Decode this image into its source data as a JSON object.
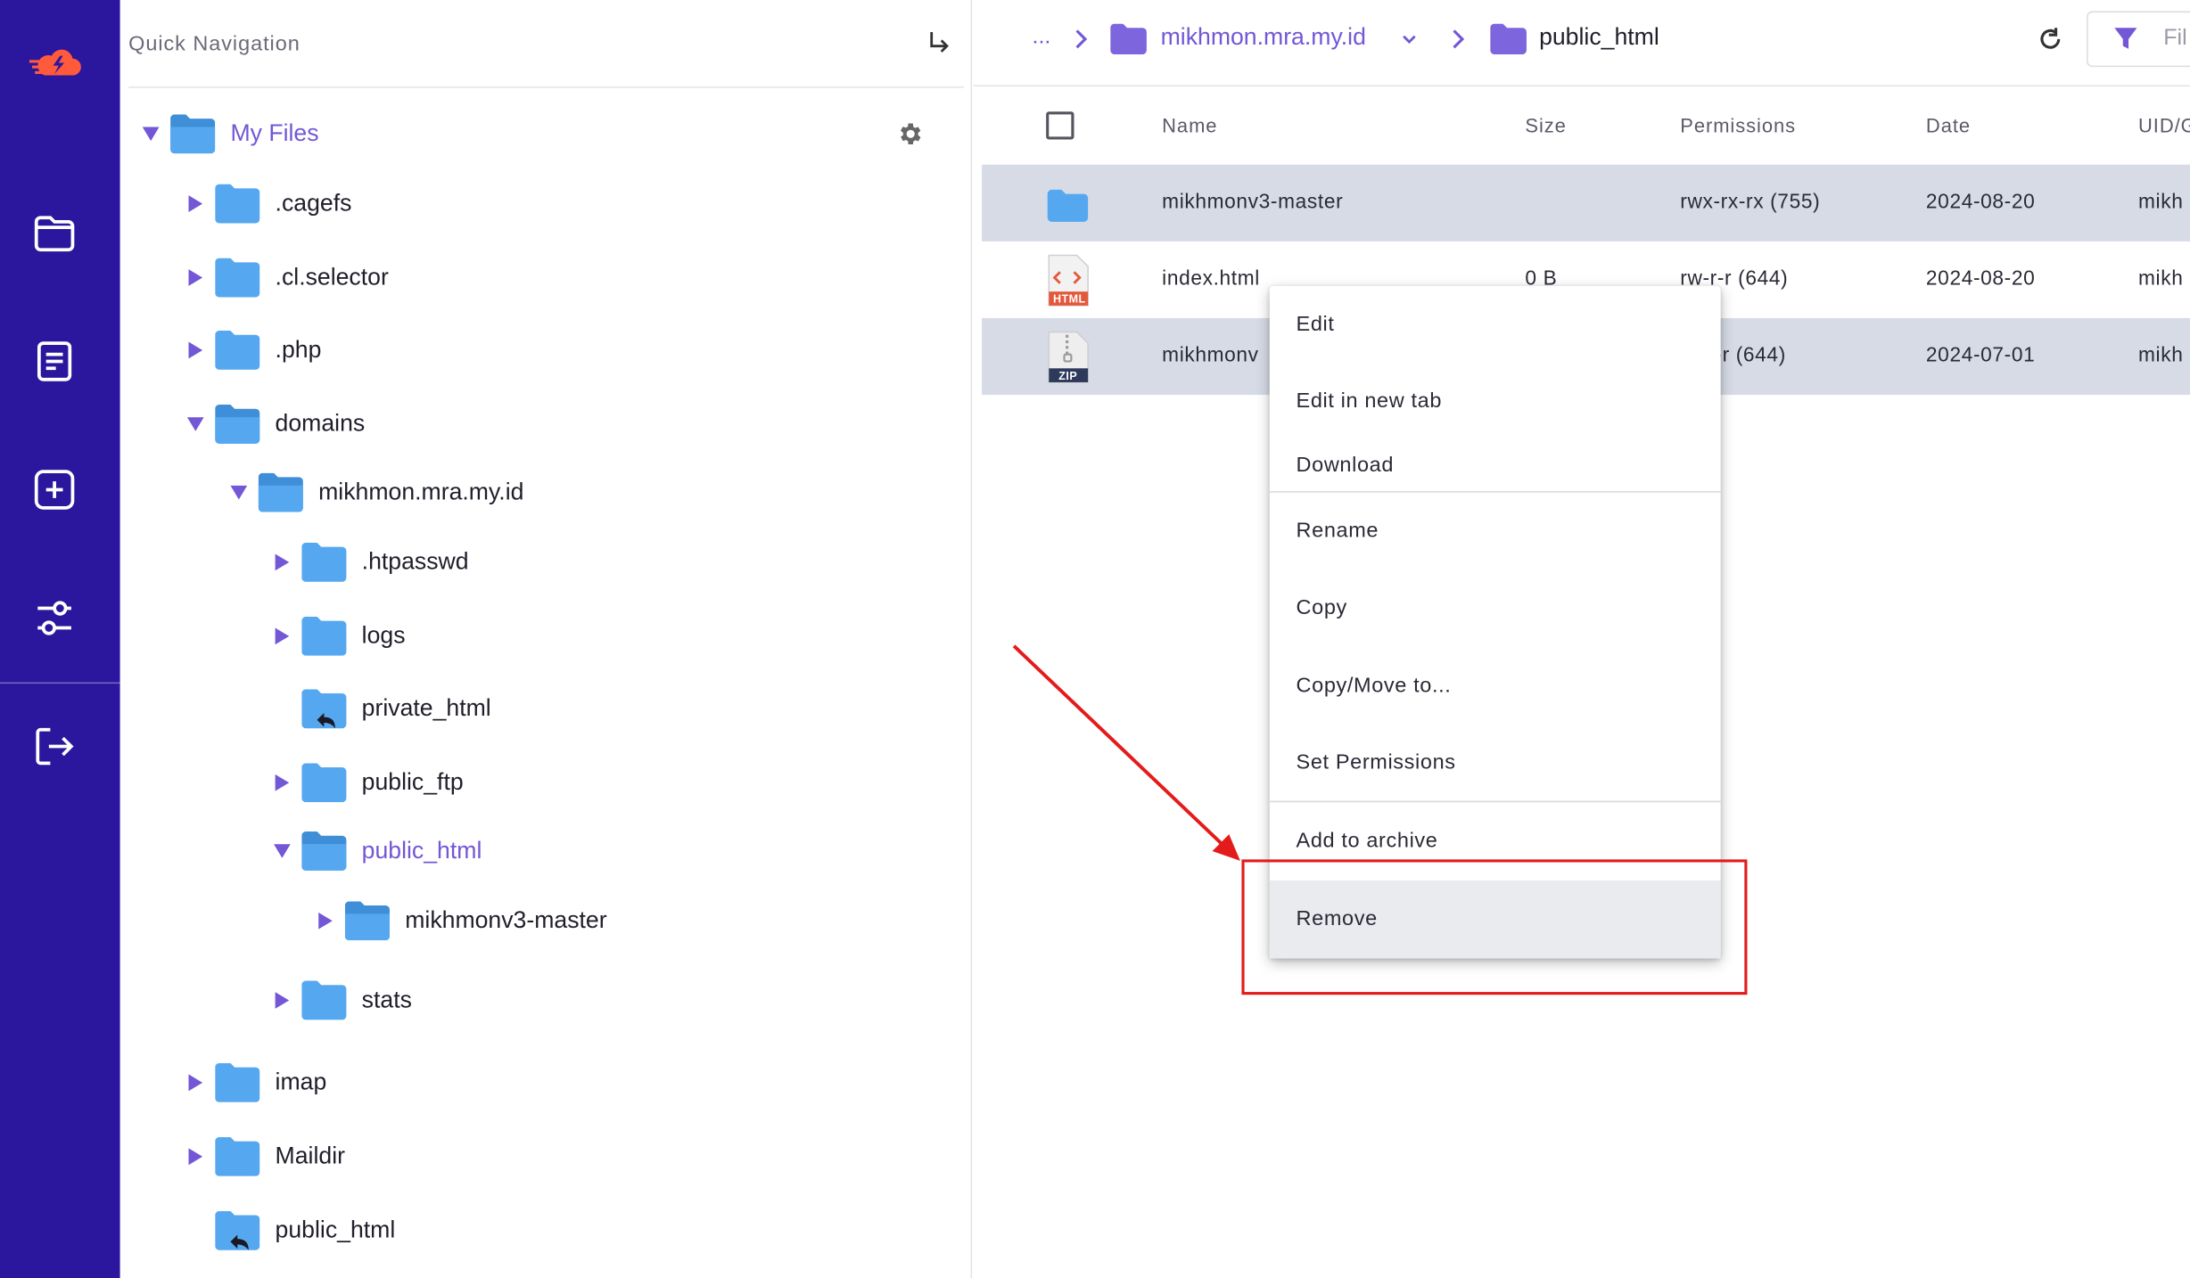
{
  "quick_nav": {
    "label": "Quick Navigation"
  },
  "tree": {
    "root": {
      "label": "My Files"
    },
    "items": [
      {
        "label": ".cagefs"
      },
      {
        "label": ".cl.selector"
      },
      {
        "label": ".php"
      },
      {
        "label": "domains"
      },
      {
        "label": "mikhmon.mra.my.id"
      },
      {
        "label": ".htpasswd"
      },
      {
        "label": "logs"
      },
      {
        "label": "private_html"
      },
      {
        "label": "public_ftp"
      },
      {
        "label": "public_html"
      },
      {
        "label": "mikhmonv3-master"
      },
      {
        "label": "stats"
      },
      {
        "label": "imap"
      },
      {
        "label": "Maildir"
      },
      {
        "label": "public_html"
      }
    ]
  },
  "breadcrumb": {
    "dots": "...",
    "parent": "mikhmon.mra.my.id",
    "current": "public_html"
  },
  "toolbar": {
    "filter_label": "Fil"
  },
  "table": {
    "headers": {
      "name": "Name",
      "size": "Size",
      "permissions": "Permissions",
      "date": "Date",
      "uid": "UID/G"
    },
    "rows": [
      {
        "name": "mikhmonv3-master",
        "size": "",
        "permissions": "rwx-rx-rx (755)",
        "date": "2024-08-20",
        "uid": "mikh"
      },
      {
        "name": "index.html",
        "size": "0 B",
        "permissions": "rw-r-r (644)",
        "date": "2024-08-20",
        "uid": "mikh",
        "badge": "HTML"
      },
      {
        "name": "mikhmonv",
        "size": "",
        "permissions": "-r (644)",
        "date": "2024-07-01",
        "uid": "mikh",
        "badge": "ZIP"
      }
    ]
  },
  "context_menu": {
    "items": [
      {
        "label": "Edit"
      },
      {
        "label": "Edit in new tab"
      },
      {
        "label": "Download"
      },
      {
        "label": "Rename"
      },
      {
        "label": "Copy"
      },
      {
        "label": "Copy/Move to..."
      },
      {
        "label": "Set Permissions"
      },
      {
        "label": "Add to archive"
      },
      {
        "label": "Remove"
      }
    ]
  },
  "colors": {
    "rail": "#2b169e",
    "accent": "#7357d6",
    "folder": "#55a8f0",
    "annotation": "#e41b1b",
    "selected_row": "#d6dbe5"
  }
}
